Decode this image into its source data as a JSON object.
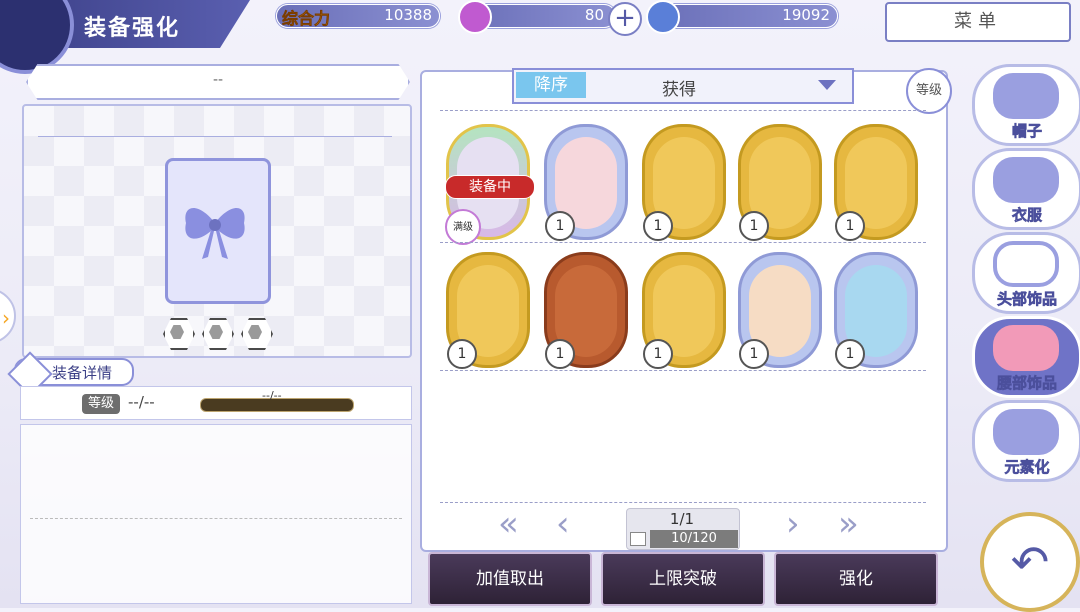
{
  "title": "装备强化",
  "stats": {
    "power_label": "综合力",
    "power": "10388",
    "stamina": "80",
    "currency": "19092"
  },
  "menu_label": "菜单",
  "equip": {
    "name": "--",
    "detail_label": "装备详情",
    "level_label": "等级",
    "level_value": "--/--",
    "xp_text": "--/--"
  },
  "sort": {
    "order_label": "降序",
    "field": "获得",
    "level_button": "等级"
  },
  "items_row1": [
    {
      "color": "#9ad7b0",
      "count": "",
      "equipped": "装备中",
      "max": "满级"
    },
    {
      "color": "#b9c6ef",
      "count": "1"
    },
    {
      "color": "#e6b840",
      "count": "1"
    },
    {
      "color": "#e6b840",
      "count": "1"
    },
    {
      "color": "#e6b840",
      "count": "1"
    }
  ],
  "items_row2": [
    {
      "color": "#e6b840",
      "count": "1"
    },
    {
      "color": "#b85a2e",
      "count": "1"
    },
    {
      "color": "#e6b840",
      "count": "1"
    },
    {
      "color": "#b9c6ef",
      "count": "1"
    },
    {
      "color": "#b9c6ef",
      "count": "1"
    }
  ],
  "pagination": {
    "page": "1/1",
    "count": "10/120"
  },
  "buttons": {
    "extract": "加值取出",
    "limit_break": "上限突破",
    "enhance": "强化"
  },
  "categories": [
    {
      "label": "帽子",
      "icon": "hat-icon"
    },
    {
      "label": "衣服",
      "icon": "dress-icon"
    },
    {
      "label": "头部饰品",
      "icon": "glasses-icon"
    },
    {
      "label": "腰部饰品",
      "icon": "bow-icon"
    },
    {
      "label": "元素化",
      "icon": "element-icon"
    }
  ]
}
